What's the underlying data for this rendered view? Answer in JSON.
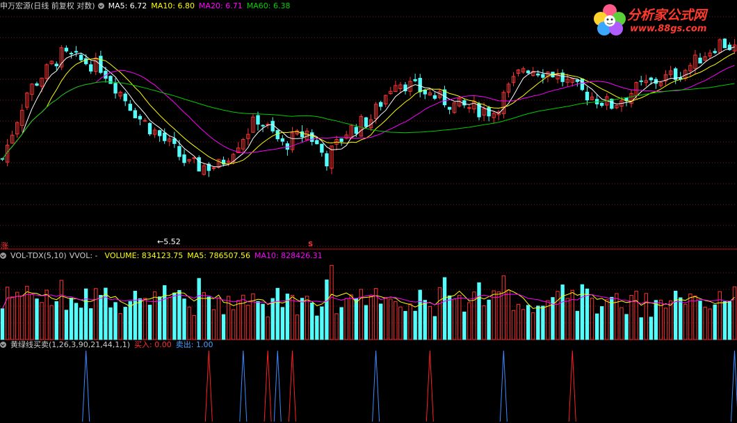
{
  "colors": {
    "up": "#ff3232",
    "down": "#54fcfc",
    "ma5": "#ffffff",
    "ma10": "#ffff00",
    "ma20": "#ff00ff",
    "ma60": "#00cc00",
    "buy": "#ff2020",
    "sell": "#3a8dff",
    "grid": "#7a1a1a",
    "divider": "#c01010"
  },
  "price_panel": {
    "title": "申万宏源(日线 前复权 对数)",
    "ma5_label": "MA5: 6.72",
    "ma10_label": "MA10: 6.80",
    "ma20_label": "MA20: 6.71",
    "ma60_label": "MA60: 6.38",
    "low_marker": "5.52",
    "zhang_label": "涨",
    "s_marker": "S"
  },
  "volume_panel": {
    "title": "VOL-TDX(5,10)",
    "vvol_label": "VVOL: -",
    "volume_label": "VOLUME: 834123.75",
    "ma5_label": "MA5: 786507.56",
    "ma10_label": "MA10: 828426.31"
  },
  "signal_panel": {
    "title": "黄绿线买卖(1,26,3,90,21,44,1,1)",
    "buy_label": "买入: 0.00",
    "sell_label": "卖出: 1.00"
  },
  "logo": {
    "name": "分析家公式网",
    "url": "www.88gs.com"
  },
  "chart_data": {
    "type": "candlestick",
    "bar_count": 150,
    "price_low_marked": 5.52,
    "buy_signal_bars": [
      42,
      54,
      59,
      87,
      116
    ],
    "sell_signal_bars": [
      17,
      49,
      56,
      76,
      102,
      149
    ]
  }
}
